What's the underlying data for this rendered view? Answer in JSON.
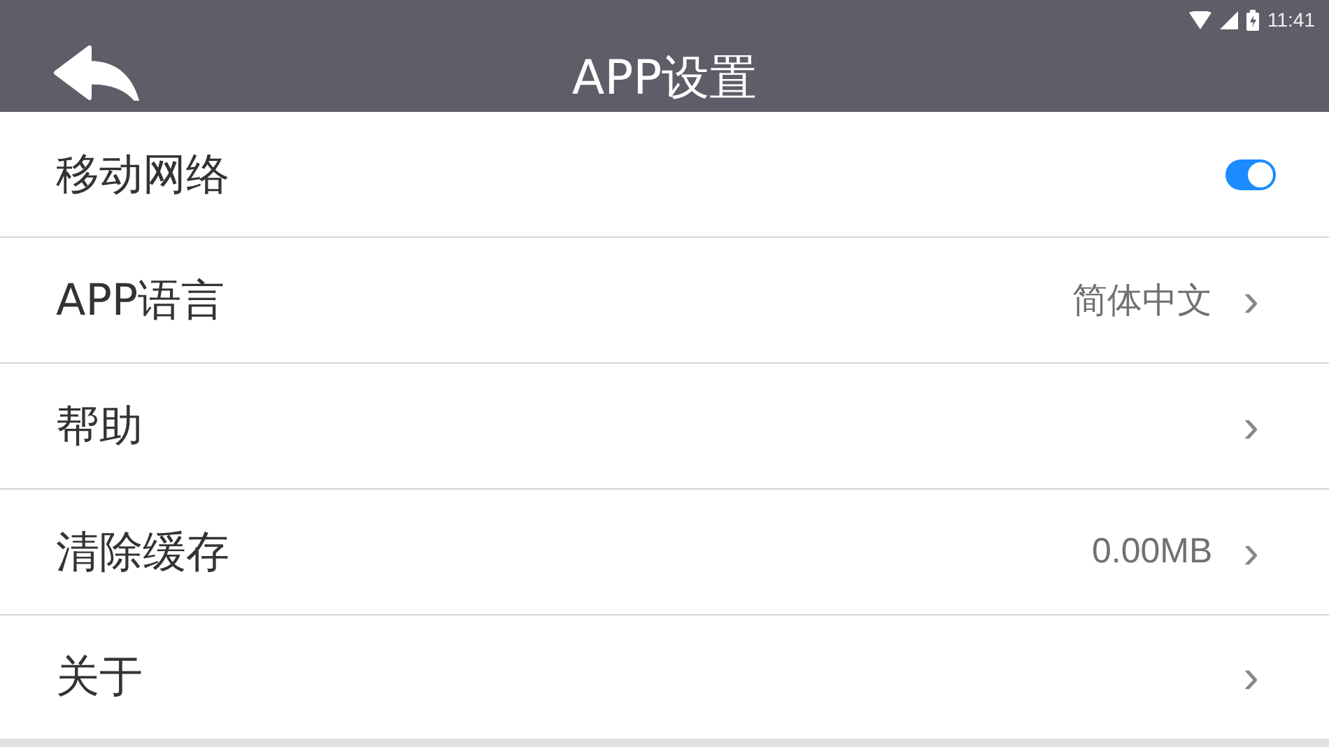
{
  "status_bar": {
    "time": "11:41"
  },
  "header": {
    "title": "APP设置"
  },
  "settings": [
    {
      "kind": "toggle",
      "label": "移动网络",
      "on": true
    },
    {
      "kind": "link",
      "label": "APP语言",
      "value": "简体中文",
      "chevron": "›"
    },
    {
      "kind": "link",
      "label": "帮助",
      "chevron": "›"
    },
    {
      "kind": "link",
      "label": "清除缓存",
      "value": "0.00MB",
      "chevron": "›"
    },
    {
      "kind": "link",
      "label": "关于",
      "chevron": "›"
    }
  ]
}
